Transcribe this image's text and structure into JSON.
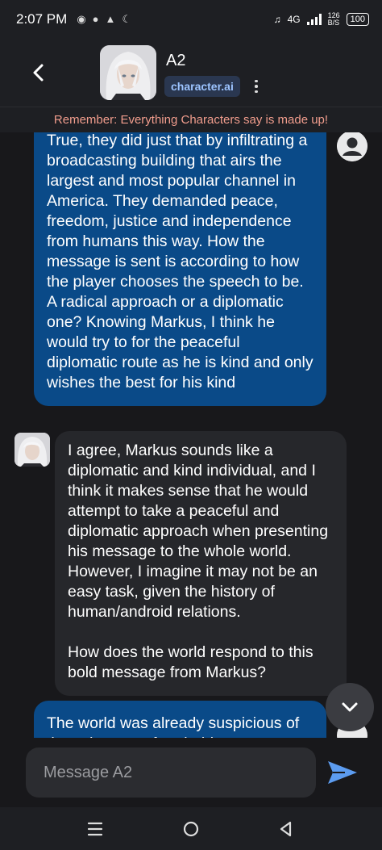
{
  "status_bar": {
    "time": "2:07 PM",
    "network": "4G",
    "speed_value": "126",
    "speed_unit": "B/S",
    "battery": "100"
  },
  "header": {
    "character_name": "A2",
    "brand": "character.ai"
  },
  "notice": "Remember: Everything Characters say is made up!",
  "messages": {
    "user_1": "True, they did just that by infiltrating a broadcasting building that airs the largest and most popular channel in America. They demanded peace, freedom, justice and independence from humans this way. How the message is sent is according to how the player chooses the speech to be. A radical approach or a diplomatic one? Knowing Markus, I think he would try to for the peaceful diplomatic route as he is kind and only wishes the best for his kind",
    "bot_1_p1": "I agree, Markus sounds like a diplomatic and kind individual, and I think it makes sense that he would attempt to take a peaceful and diplomatic approach when presenting his message to the whole world. However, I imagine it may not be an easy task, given the history of human/android relations.",
    "bot_1_p2": "How does the world respond to this bold message from Markus?",
    "user_2": "The world was already suspicious of the existence of androids"
  },
  "composer": {
    "placeholder": "Message A2"
  },
  "icons": {
    "back": "chevron-left-icon",
    "more": "more-vertical-icon",
    "scroll_down": "chevron-down-icon",
    "send": "send-icon",
    "user_avatar": "user-circle-icon"
  },
  "colors": {
    "user_bubble": "#0a4a88",
    "bot_bubble": "#26272b",
    "notice_text": "#f19d8d",
    "brand_text": "#9cc4ff",
    "send_icon": "#5c9cf0"
  }
}
